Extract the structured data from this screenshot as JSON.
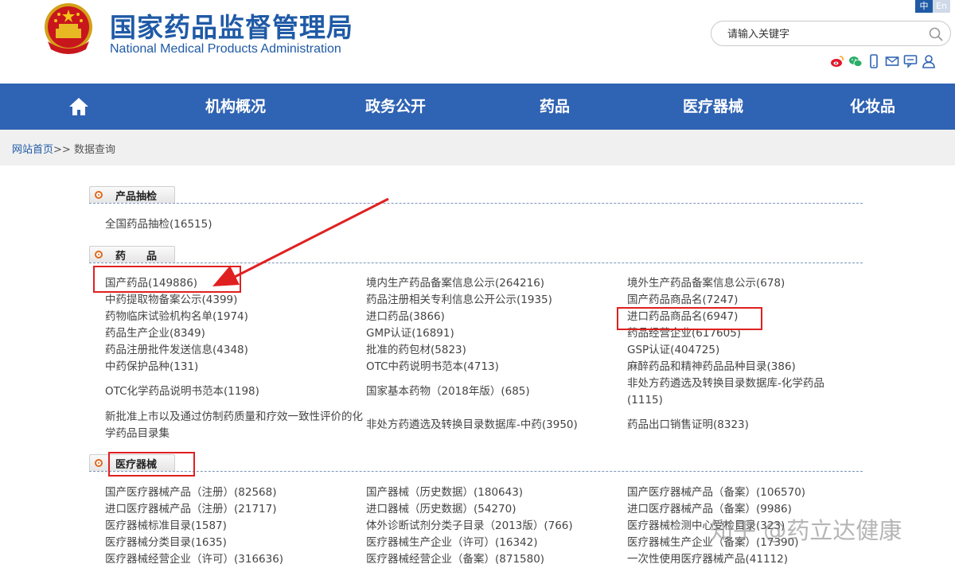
{
  "header": {
    "title_cn": "国家药品监督管理局",
    "title_en": "National Medical Products Administration",
    "lang_cn": "中",
    "lang_en": "En",
    "search_placeholder": "请输入关键字",
    "social_icons": [
      "weibo-icon",
      "wechat-icon",
      "mobile-icon",
      "mail-icon",
      "feedback-icon",
      "user-icon"
    ]
  },
  "nav": {
    "items": [
      "机构概况",
      "政务公开",
      "药品",
      "医疗器械",
      "化妆品"
    ]
  },
  "breadcrumb": {
    "home": "网站首页",
    "separator": ">>",
    "current": "数据查询"
  },
  "sections": {
    "sampling": {
      "title": "产品抽检",
      "links": [
        "全国药品抽检(16515)"
      ]
    },
    "drugs": {
      "title": "药　　品",
      "links": [
        "国产药品(149886)",
        "境内生产药品备案信息公示(264216)",
        "境外生产药品备案信息公示(678)",
        "中药提取物备案公示(4399)",
        "药品注册相关专利信息公开公示(1935)",
        "国产药品商品名(7247)",
        "药物临床试验机构名单(1974)",
        "进口药品(3866)",
        "进口药品商品名(6947)",
        "药品生产企业(8349)",
        "GMP认证(16891)",
        "药品经营企业(617605)",
        "药品注册批件发送信息(4348)",
        "批准的药包材(5823)",
        "GSP认证(404725)",
        "中药保护品种(131)",
        "OTC中药说明书范本(4713)",
        "麻醉药品和精神药品品种目录(386)",
        "OTC化学药品说明书范本(1198)",
        "国家基本药物（2018年版）(685)",
        "非处方药遴选及转换目录数据库-化学药品(1115)",
        "新批准上市以及通过仿制药质量和疗效一致性评价的化学药品目录集",
        "非处方药遴选及转换目录数据库-中药(3950)",
        "药品出口销售证明(8323)"
      ]
    },
    "devices": {
      "title": "医疗器械",
      "links": [
        "国产医疗器械产品（注册）(82568)",
        "国产器械（历史数据）(180643)",
        "国产医疗器械产品（备案）(106570)",
        "进口医疗器械产品（注册）(21717)",
        "进口器械（历史数据）(54270)",
        "进口医疗器械产品（备案）(9986)",
        "医疗器械标准目录(1587)",
        "体外诊断试剂分类子目录（2013版）(766)",
        "医疗器械检测中心受检目录(323)",
        "医疗器械分类目录(1635)",
        "医疗器械生产企业（许可）(16342)",
        "医疗器械生产企业（备案）(17390)",
        "医疗器械经营企业（许可）(316636)",
        "医疗器械经营企业（备案）(871580)",
        "一次性使用医疗器械产品(41112)"
      ]
    }
  },
  "watermark": "知乎 @药立达健康",
  "colors": {
    "brand_blue": "#1f5aa6",
    "nav_blue": "#2f63b3",
    "highlight_red": "#e02020",
    "bullet_orange": "#e0681b"
  }
}
